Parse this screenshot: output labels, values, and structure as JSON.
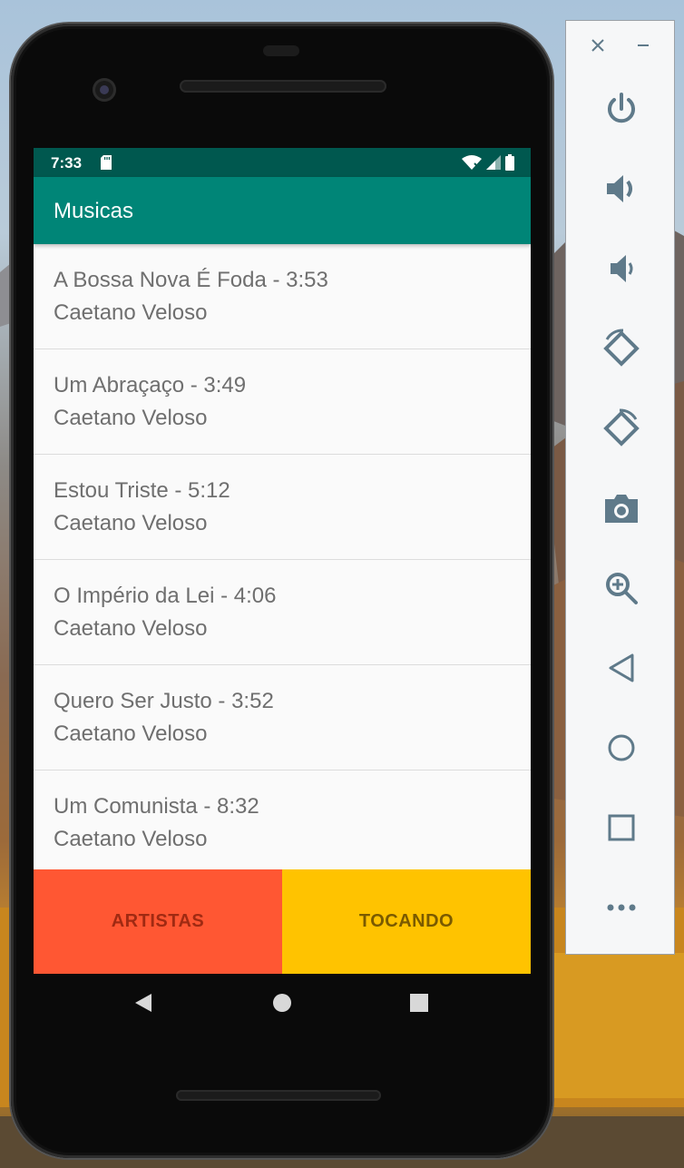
{
  "status_bar": {
    "time": "7:33"
  },
  "app_bar": {
    "title": "Musicas"
  },
  "songs": [
    {
      "title": "A Bossa Nova É Foda - 3:53",
      "artist": "Caetano Veloso"
    },
    {
      "title": "Um Abraçaço - 3:49",
      "artist": "Caetano Veloso"
    },
    {
      "title": "Estou Triste - 5:12",
      "artist": "Caetano Veloso"
    },
    {
      "title": "O Império da Lei - 4:06",
      "artist": "Caetano Veloso"
    },
    {
      "title": "Quero Ser Justo - 3:52",
      "artist": "Caetano Veloso"
    },
    {
      "title": "Um Comunista - 8:32",
      "artist": "Caetano Veloso"
    }
  ],
  "buttons": {
    "artistas": "ARTISTAS",
    "tocando": "TOCANDO"
  },
  "colors": {
    "status_bar": "#00584f",
    "app_bar": "#008577",
    "artistas_button": "#ff5733",
    "tocando_button": "#ffc300",
    "panel_icon": "#5f7a8a"
  },
  "emulator_panel": {
    "icons": [
      "close-icon",
      "minimize-icon",
      "power-icon",
      "volume-up-icon",
      "volume-down-icon",
      "rotate-left-icon",
      "rotate-right-icon",
      "camera-icon",
      "zoom-icon",
      "back-icon",
      "home-icon",
      "overview-icon",
      "more-icon"
    ]
  }
}
